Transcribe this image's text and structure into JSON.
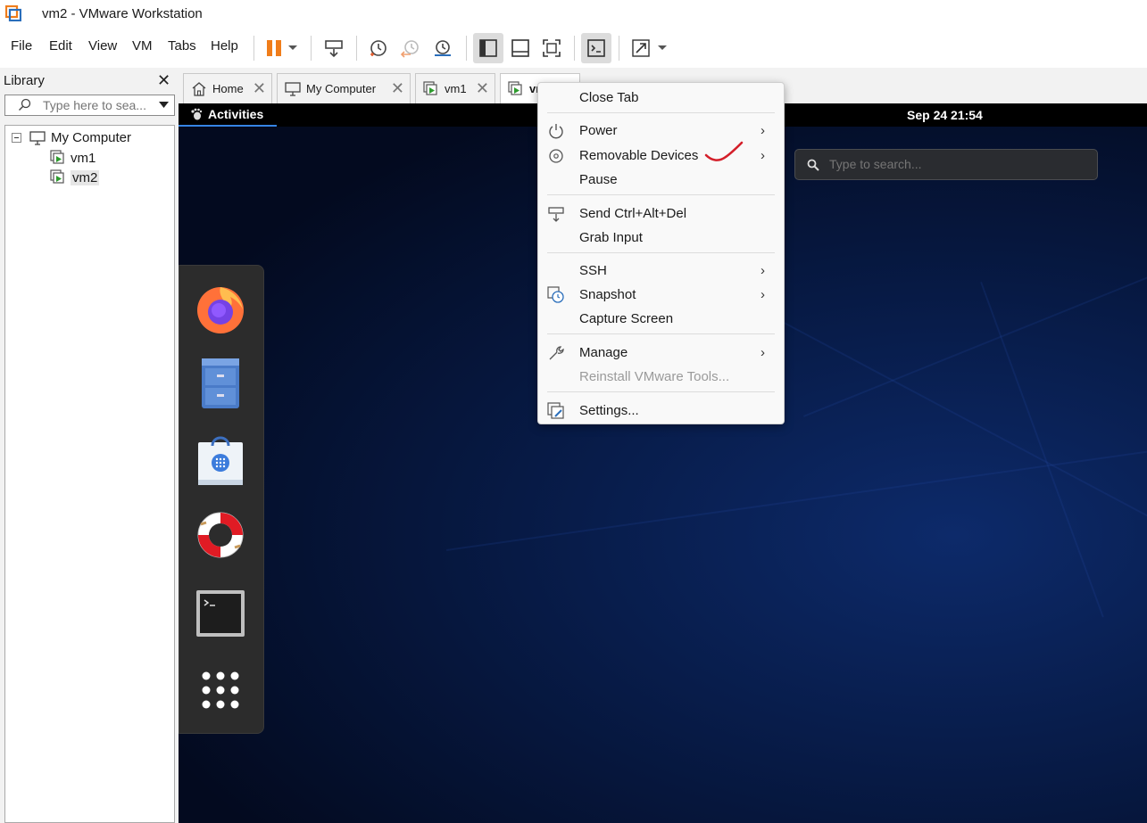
{
  "window": {
    "title": "vm2 - VMware Workstation"
  },
  "menu": [
    {
      "label": "File"
    },
    {
      "label": "Edit"
    },
    {
      "label": "View"
    },
    {
      "label": "VM"
    },
    {
      "label": "Tabs"
    },
    {
      "label": "Help"
    }
  ],
  "toolbar": {
    "icons": [
      "pause-icon",
      "dropdown-arrow-icon",
      "send-ctrl-alt-del-icon",
      "take-snapshot-icon",
      "revert-snapshot-icon",
      "snapshot-manager-icon",
      "show-library-icon",
      "thumbnail-bar-icon",
      "full-screen-icon",
      "console-view-icon",
      "unity-stretch-icon"
    ]
  },
  "library": {
    "title": "Library",
    "search_placeholder": "Type here to sea...",
    "tree": [
      {
        "label": "My Computer"
      },
      {
        "label": "vm1"
      },
      {
        "label": "vm2"
      }
    ]
  },
  "tabs": [
    {
      "label": "Home"
    },
    {
      "label": "My Computer"
    },
    {
      "label": "vm1"
    },
    {
      "label": "vm"
    }
  ],
  "guest": {
    "activities": "Activities",
    "clock": "Sep 24  21:54",
    "search_placeholder": "Type to search..."
  },
  "context_menu": {
    "items": [
      {
        "label": "Close Tab"
      },
      {
        "label": "Power",
        "submenu": true
      },
      {
        "label": "Removable Devices",
        "submenu": true
      },
      {
        "label": "Pause"
      },
      {
        "label": "Send Ctrl+Alt+Del"
      },
      {
        "label": "Grab Input"
      },
      {
        "label": "SSH",
        "submenu": true
      },
      {
        "label": "Snapshot",
        "submenu": true
      },
      {
        "label": "Capture Screen"
      },
      {
        "label": "Manage",
        "submenu": true
      },
      {
        "label": "Reinstall VMware Tools...",
        "disabled": true
      },
      {
        "label": "Settings..."
      }
    ],
    "arrow": "›"
  },
  "colors": {
    "pause_orange": "#f07d1a",
    "vm_green": "#2e9b2e",
    "annotation_red": "#d41f2a",
    "guest_accent": "#3584e4"
  }
}
